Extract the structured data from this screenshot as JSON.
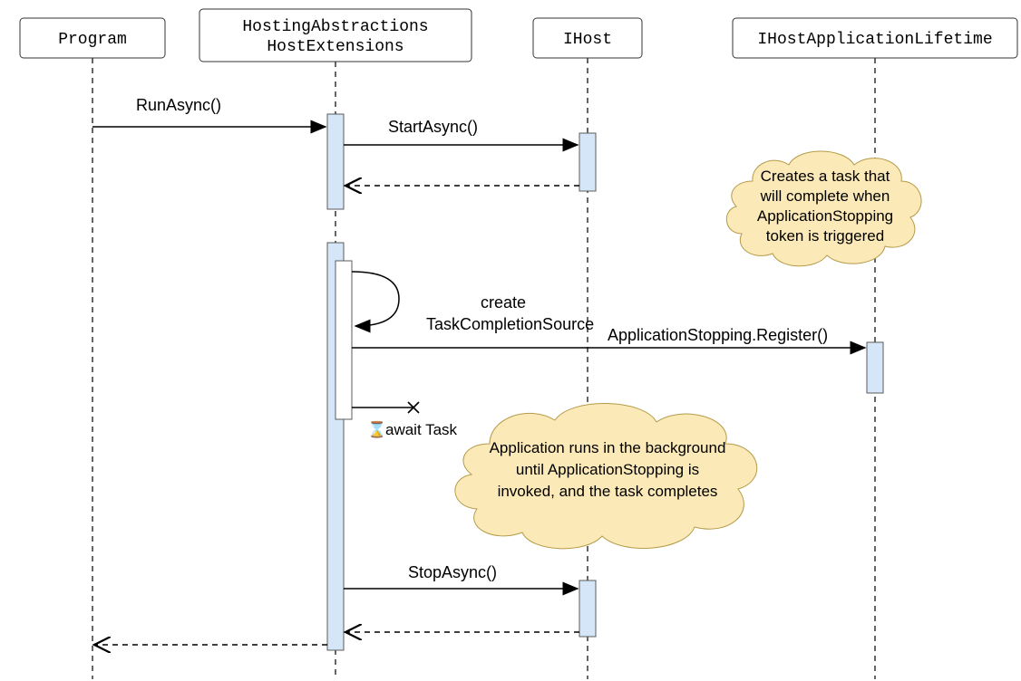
{
  "participants": {
    "program": "Program",
    "hostExt_line1": "HostingAbstractions",
    "hostExt_line2": "HostExtensions",
    "ihost": "IHost",
    "lifetime": "IHostApplicationLifetime"
  },
  "messages": {
    "runAsync": "RunAsync()",
    "startAsync": "StartAsync()",
    "createTcs_l1": "create",
    "createTcs_l2": "TaskCompletionSource",
    "appStoppingRegister": "ApplicationStopping.Register()",
    "awaitTask": "await Task",
    "stopAsync": "StopAsync()"
  },
  "notes": {
    "note1_l1": "Creates a task that",
    "note1_l2": "will complete when",
    "note1_l3": "ApplicationStopping",
    "note1_l4": "token is triggered",
    "note2_l1": "Application runs in the background",
    "note2_l2": "until ApplicationStopping is",
    "note2_l3": "invoked, and the task completes"
  },
  "chart_data": {
    "type": "sequence_diagram",
    "participants": [
      "Program",
      "HostingAbstractionsHostExtensions",
      "IHost",
      "IHostApplicationLifetime"
    ],
    "interactions": [
      {
        "from": "Program",
        "to": "HostingAbstractionsHostExtensions",
        "label": "RunAsync()",
        "kind": "sync"
      },
      {
        "from": "HostingAbstractionsHostExtensions",
        "to": "IHost",
        "label": "StartAsync()",
        "kind": "sync"
      },
      {
        "from": "IHost",
        "to": "HostingAbstractionsHostExtensions",
        "label": "",
        "kind": "return"
      },
      {
        "from": "HostingAbstractionsHostExtensions",
        "to": "HostingAbstractionsHostExtensions",
        "label": "create TaskCompletionSource",
        "kind": "self"
      },
      {
        "from": "HostingAbstractionsHostExtensions",
        "to": "IHostApplicationLifetime",
        "label": "ApplicationStopping.Register()",
        "kind": "sync"
      },
      {
        "from": "HostingAbstractionsHostExtensions",
        "to": "HostingAbstractionsHostExtensions",
        "label": "await Task",
        "kind": "destroy",
        "annotation": "Application runs in the background until ApplicationStopping is invoked, and the task completes"
      },
      {
        "from": "HostingAbstractionsHostExtensions",
        "to": "IHost",
        "label": "StopAsync()",
        "kind": "sync"
      },
      {
        "from": "IHost",
        "to": "HostingAbstractionsHostExtensions",
        "label": "",
        "kind": "return"
      },
      {
        "from": "HostingAbstractionsHostExtensions",
        "to": "Program",
        "label": "",
        "kind": "return"
      }
    ],
    "notes": [
      {
        "near": "IHostApplicationLifetime",
        "text": "Creates a task that will complete when ApplicationStopping token is triggered"
      },
      {
        "near": "IHost",
        "text": "Application runs in the background until ApplicationStopping is invoked, and the task completes"
      }
    ]
  }
}
